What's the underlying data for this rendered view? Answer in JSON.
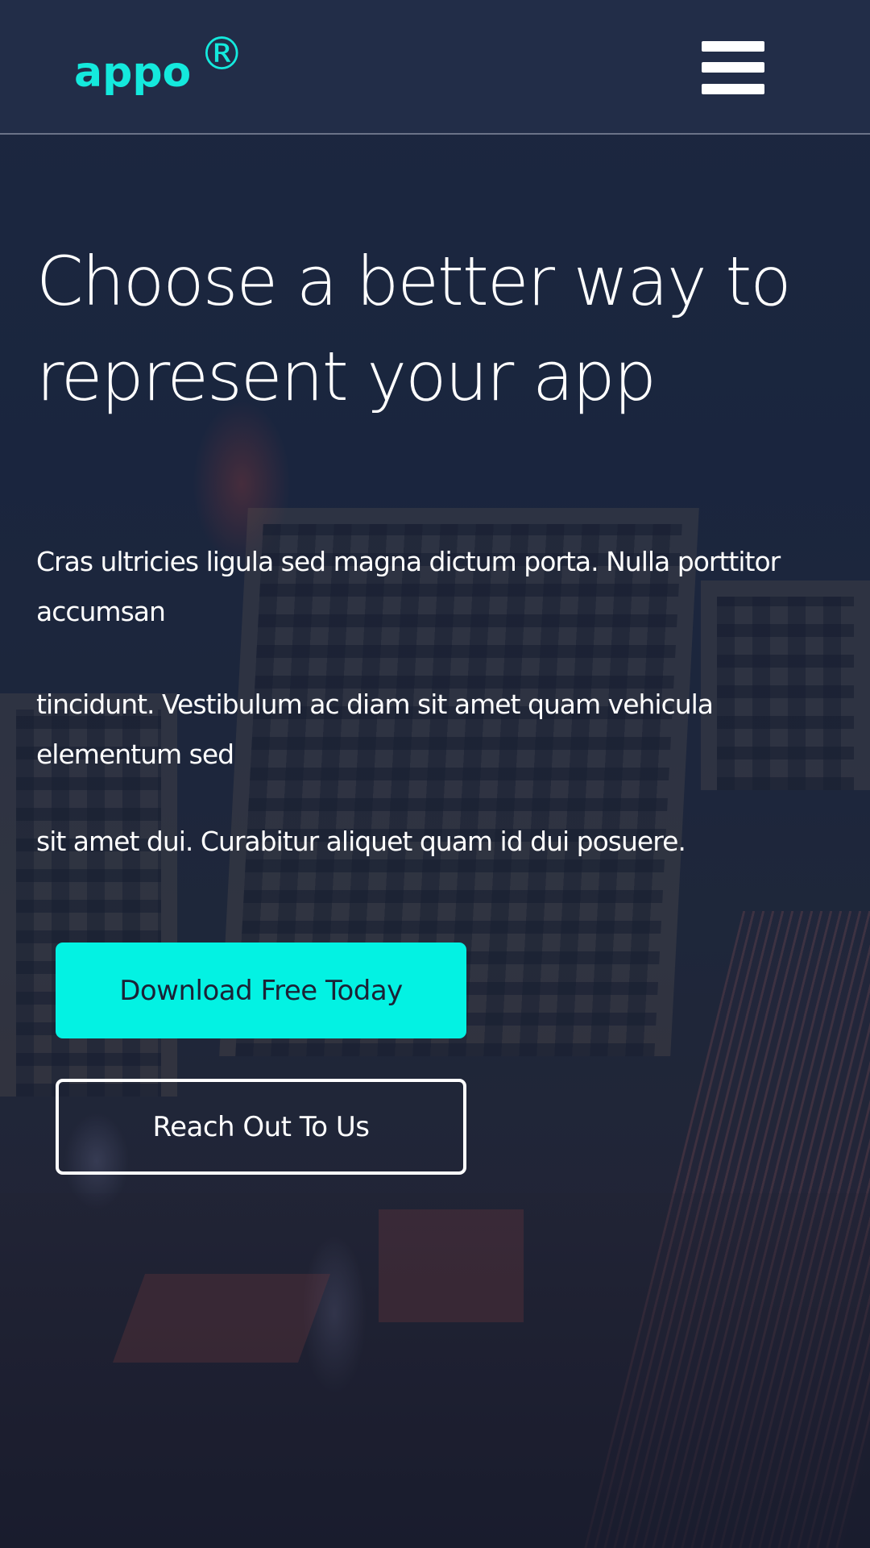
{
  "header": {
    "logo_text": "appo",
    "logo_mark": "®",
    "menu_icon": "hamburger-menu-icon"
  },
  "hero": {
    "headline": "Choose a better way to represent your app",
    "paragraphs": [
      "Cras ultricies ligula sed magna dictum porta. Nulla porttitor accumsan",
      "tincidunt. Vestibulum ac diam sit amet quam vehicula elementum sed",
      "sit amet dui. Curabitur aliquet quam id dui posuere."
    ],
    "primary_button": "Download Free Today",
    "secondary_button": "Reach Out To Us"
  },
  "colors": {
    "accent": "#03f2e3",
    "logo": "#14e9dd",
    "header_bg": "#222d48",
    "text": "#ffffff"
  }
}
